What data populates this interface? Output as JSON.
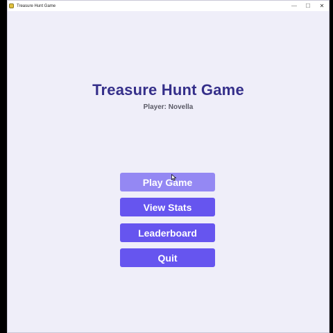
{
  "window": {
    "title": "Treasure Hunt Game",
    "minimize_glyph": "—",
    "maximize_glyph": "☐",
    "close_glyph": "✕"
  },
  "main": {
    "game_title": "Treasure Hunt Game",
    "player_label": "Player: Novella"
  },
  "menu": {
    "play_label": "Play Game",
    "stats_label": "View Stats",
    "leaderboard_label": "Leaderboard",
    "quit_label": "Quit"
  },
  "colors": {
    "background": "#efeef9",
    "title": "#352f8a",
    "button": "#6655ef",
    "button_hover": "#9488f3"
  }
}
